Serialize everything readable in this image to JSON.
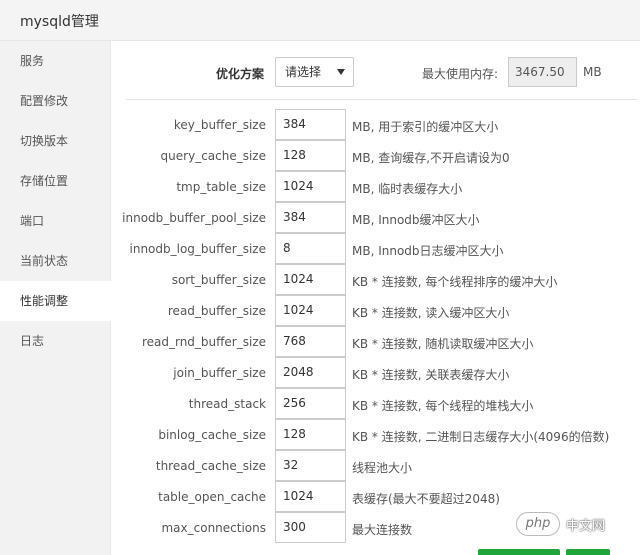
{
  "window": {
    "title": "mysqld管理"
  },
  "sidebar": {
    "items": [
      {
        "label": "服务"
      },
      {
        "label": "配置修改"
      },
      {
        "label": "切换版本"
      },
      {
        "label": "存储位置"
      },
      {
        "label": "端口"
      },
      {
        "label": "当前状态"
      },
      {
        "label": "性能调整",
        "active": true
      },
      {
        "label": "日志"
      }
    ]
  },
  "optimize": {
    "label": "优化方案",
    "selected": "请选择",
    "max_mem_label": "最大使用内存:",
    "max_mem_value": "3467.50",
    "max_mem_unit": "MB"
  },
  "params": [
    {
      "name": "key_buffer_size",
      "value": "384",
      "desc": "MB, 用于索引的缓冲区大小"
    },
    {
      "name": "query_cache_size",
      "value": "128",
      "desc": "MB, 查询缓存,不开启请设为0"
    },
    {
      "name": "tmp_table_size",
      "value": "1024",
      "desc": "MB, 临时表缓存大小"
    },
    {
      "name": "innodb_buffer_pool_size",
      "value": "384",
      "desc": "MB, Innodb缓冲区大小"
    },
    {
      "name": "innodb_log_buffer_size",
      "value": "8",
      "desc": "MB, Innodb日志缓冲区大小"
    },
    {
      "name": "sort_buffer_size",
      "value": "1024",
      "desc": "KB * 连接数, 每个线程排序的缓冲大小"
    },
    {
      "name": "read_buffer_size",
      "value": "1024",
      "desc": "KB * 连接数, 读入缓冲区大小"
    },
    {
      "name": "read_rnd_buffer_size",
      "value": "768",
      "desc": "KB * 连接数, 随机读取缓冲区大小"
    },
    {
      "name": "join_buffer_size",
      "value": "2048",
      "desc": "KB * 连接数, 关联表缓存大小"
    },
    {
      "name": "thread_stack",
      "value": "256",
      "desc": "KB * 连接数, 每个线程的堆栈大小"
    },
    {
      "name": "binlog_cache_size",
      "value": "128",
      "desc": "KB * 连接数, 二进制日志缓存大小(4096的倍数)"
    },
    {
      "name": "thread_cache_size",
      "value": "32",
      "desc": "线程池大小"
    },
    {
      "name": "table_open_cache",
      "value": "1024",
      "desc": "表缓存(最大不要超过2048)"
    },
    {
      "name": "max_connections",
      "value": "300",
      "desc": "最大连接数"
    }
  ],
  "watermark": {
    "logo": "php",
    "text": "中文网"
  },
  "colors": {
    "accent_green": "#20a53a",
    "sidebar_bg": "#f2f2f2",
    "titlebar_bg": "#f4f4f4"
  }
}
